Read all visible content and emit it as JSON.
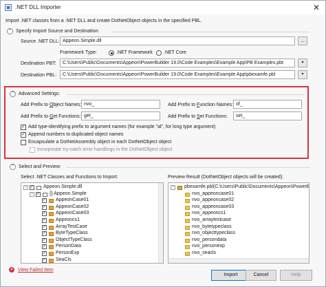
{
  "window": {
    "title": ".NET DLL Importer",
    "close_glyph": "✕",
    "intro": "Import .NET classes from a .NET DLL and create DotNetObject objects in the specified PBL."
  },
  "source_section": {
    "title": "Specify Import Source and Destination:",
    "source_label": "Source .NET DLL:",
    "source_value": "Appeon.Simple.dll",
    "browse_label": "...",
    "framework_label": "Framework Type:",
    "framework_options": [
      ".NET Framework",
      ".NET Core"
    ],
    "framework_selected": ".NET Framework",
    "dest_pbt_label": "Destination PBT:",
    "dest_pbt_value": "C:\\Users\\Public\\Documents\\Appeon\\PowerBuilder 19.0\\Code Examples\\Example App\\PB Examples.pbt",
    "dest_pbl_label": "Destination PBL:",
    "dest_pbl_value": "C:\\Users\\Public\\Documents\\Appeon\\PowerBuilder 19.0\\Code Examples\\Example App\\pbexamfe.pbl"
  },
  "advanced_section": {
    "title": "Advanced Settings:",
    "prefix_object_label_pre": "Add Prefix to ",
    "prefix_object_label_key": "O",
    "prefix_object_label_post": "bject Names:",
    "prefix_object_value": "nvo_",
    "prefix_function_label_pre": "Add Prefix to ",
    "prefix_function_label_key": "F",
    "prefix_function_label_post": "unction Names:",
    "prefix_function_value": "of_",
    "prefix_get_label_pre": "Add Prefix to ",
    "prefix_get_label_key": "G",
    "prefix_get_label_post": "et Functions:",
    "prefix_get_value": "get_",
    "prefix_set_label_pre": "Add Prefix to ",
    "prefix_set_label_key": "S",
    "prefix_set_label_post": "et Functions:",
    "prefix_set_value": "set_",
    "check_type_prefix": "Add type-identifying prefix to argument names (for example \"al\", for long type argument)",
    "check_append_numbers": "Append numbers to duplicated object names",
    "check_encapsulate": "Encapsulate a DotNetAssembly object in each DotNetObject object",
    "check_trycatch": "Incorporate try-catch error handlings in the DotNetObject object"
  },
  "preview_section": {
    "title": "Select and Preview:",
    "left_label": "Select .NET Classes and Functions to Import:",
    "right_label": "Preview Result (DotNetObject objects will be created):",
    "left_tree": [
      {
        "text": "Appeon.Simple.dll",
        "level": 0,
        "icon": "dll"
      },
      {
        "text": "{} Appeon.Simple",
        "level": 1,
        "icon": "namespace"
      },
      {
        "text": "AppeonCase01",
        "level": 2,
        "icon": "class"
      },
      {
        "text": "AppeonCase02",
        "level": 2,
        "icon": "class"
      },
      {
        "text": "AppeonCase03",
        "level": 2,
        "icon": "class"
      },
      {
        "text": "Appeoncs1",
        "level": 2,
        "icon": "class"
      },
      {
        "text": "ArrayTestCase",
        "level": 2,
        "icon": "class"
      },
      {
        "text": "ByteTypeClass",
        "level": 2,
        "icon": "class"
      },
      {
        "text": "ObjectTypeClass",
        "level": 2,
        "icon": "class"
      },
      {
        "text": "PersonData",
        "level": 2,
        "icon": "class"
      },
      {
        "text": "PersonExp",
        "level": 2,
        "icon": "class"
      },
      {
        "text": "SeaCls",
        "level": 2,
        "icon": "class"
      }
    ],
    "right_tree": [
      {
        "text": "pbexamfe.pbl(C:\\Users\\Public\\Documents\\Appeon\\PowerBuil",
        "level": 0,
        "icon": "pbl"
      },
      {
        "text": "nvo_appeoncase01",
        "level": 1
      },
      {
        "text": "nvo_appeoncase02",
        "level": 1
      },
      {
        "text": "nvo_appeoncase03",
        "level": 1
      },
      {
        "text": "nvo_appeoncs1",
        "level": 1
      },
      {
        "text": "nvo_arraytestcase",
        "level": 1
      },
      {
        "text": "nvo_bytetypeclass",
        "level": 1
      },
      {
        "text": "nvo_objecttypeclass",
        "level": 1
      },
      {
        "text": "nvo_persondata",
        "level": 1
      },
      {
        "text": "nvo_personexp",
        "level": 1
      },
      {
        "text": "nvo_seacls",
        "level": 1
      }
    ]
  },
  "footer": {
    "view_failed": "View Failed Item",
    "import": "Import",
    "cancel": "Cancel",
    "help": "Help"
  },
  "colors": {
    "highlight_border": "#d9333d",
    "primary_button_border": "#0078d7"
  }
}
